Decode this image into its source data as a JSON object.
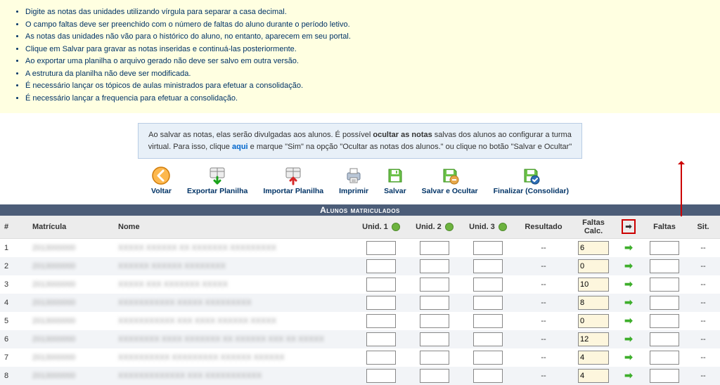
{
  "instructions": [
    "Digite as notas das unidades utilizando vírgula para separar a casa decimal.",
    "O campo faltas deve ser preenchido com o número de faltas do aluno durante o período letivo.",
    "As notas das unidades não vão para o histórico do aluno, no entanto, aparecem em seu portal.",
    "Clique em Salvar para gravar as notas inseridas e continuá-las posteriormente.",
    "Ao exportar uma planilha o arquivo gerado não deve ser salvo em outra versão.",
    "A estrutura da planilha não deve ser modificada.",
    "É necessário lançar os tópicos de aulas ministrados para efetuar a consolidação.",
    "É necessário lançar a frequencia para efetuar a consolidação."
  ],
  "notice": {
    "lead": "Ao salvar as notas, elas serão divulgadas aos alunos. É possível ",
    "strong1": "ocultar as notas",
    "mid": " salvas dos alunos ao configurar a turma virtual. Para isso, clique ",
    "link": "aqui",
    "tail": " e marque \"Sim\" na opção \"Ocultar as notas dos alunos.\" ou clique no botão \"Salvar e Ocultar\""
  },
  "toolbar": {
    "voltar": "Voltar",
    "exportar": "Exportar Planilha",
    "importar": "Importar Planilha",
    "imprimir": "Imprimir",
    "salvar": "Salvar",
    "salvar_ocultar": "Salvar e Ocultar",
    "finalizar": "Finalizar (Consolidar)"
  },
  "section_title": "Alunos matriculados",
  "headers": {
    "num": "#",
    "matricula": "Matrícula",
    "nome": "Nome",
    "un1": "Unid. 1",
    "un2": "Unid. 2",
    "un3": "Unid. 3",
    "resultado": "Resultado",
    "faltas_calc": "Faltas Calc.",
    "faltas": "Faltas",
    "sit": "Sit."
  },
  "rows": [
    {
      "n": "1",
      "mat": "2013000000",
      "nome": "XXXXX XXXXXX XX XXXXXXX XXXXXXXXX",
      "res": "--",
      "fcalc": "6",
      "sit": "--"
    },
    {
      "n": "2",
      "mat": "2013000000",
      "nome": "XXXXXX XXXXXX XXXXXXXX",
      "res": "--",
      "fcalc": "0",
      "sit": "--"
    },
    {
      "n": "3",
      "mat": "2013000000",
      "nome": "XXXXX XXX XXXXXXX XXXXX",
      "res": "--",
      "fcalc": "10",
      "sit": "--"
    },
    {
      "n": "4",
      "mat": "2013000000",
      "nome": "XXXXXXXXXXX XXXXX XXXXXXXXX",
      "res": "--",
      "fcalc": "8",
      "sit": "--"
    },
    {
      "n": "5",
      "mat": "2013000000",
      "nome": "XXXXXXXXXXX XXX XXXX XXXXXX XXXXX",
      "res": "--",
      "fcalc": "0",
      "sit": "--"
    },
    {
      "n": "6",
      "mat": "2013000000",
      "nome": "XXXXXXXX XXXX XXXXXXX XX XXXXXX XXX XX XXXXX",
      "res": "--",
      "fcalc": "12",
      "sit": "--"
    },
    {
      "n": "7",
      "mat": "2013000000",
      "nome": "XXXXXXXXXX XXXXXXXXX XXXXXX XXXXXX",
      "res": "--",
      "fcalc": "4",
      "sit": "--"
    },
    {
      "n": "8",
      "mat": "2013000000",
      "nome": "XXXXXXXXXXXXX XXX XXXXXXXXXXX",
      "res": "--",
      "fcalc": "4",
      "sit": "--"
    }
  ]
}
